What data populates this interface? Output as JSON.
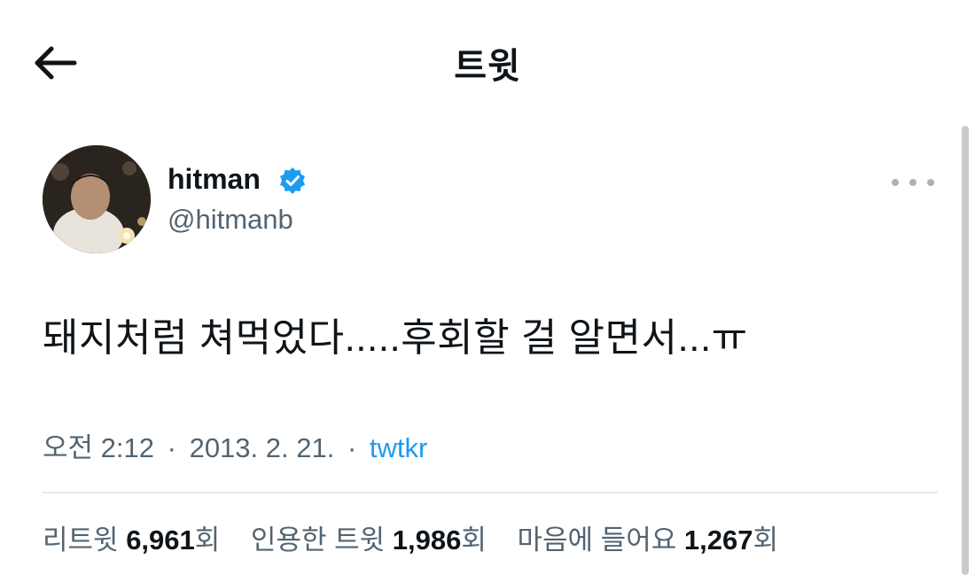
{
  "header": {
    "title": "트윗",
    "back_icon": "arrow-left-icon"
  },
  "tweet": {
    "display_name": "hitman",
    "verified_icon": "verified-badge-icon",
    "verified_color": "#1d9bf0",
    "handle": "@hitmanb",
    "more_icon": "more-horizontal-icon",
    "text": "돼지처럼 쳐먹었다.....후회할 걸 알면서...ㅠ",
    "time": "오전 2:12",
    "separator": "·",
    "date": "2013. 2. 21.",
    "source": "twtkr"
  },
  "stats": {
    "retweets_label": "리트윗",
    "retweets_count": "6,961",
    "retweets_unit": "회",
    "quotes_label": "인용한 트윗",
    "quotes_count": "1,986",
    "quotes_unit": "회",
    "likes_label": "마음에 들어요",
    "likes_count": "1,267",
    "likes_unit": "회"
  },
  "colors": {
    "text": "#0f1419",
    "secondary_text": "#536471",
    "link": "#1d9bf0",
    "divider": "#e7e9ea"
  }
}
